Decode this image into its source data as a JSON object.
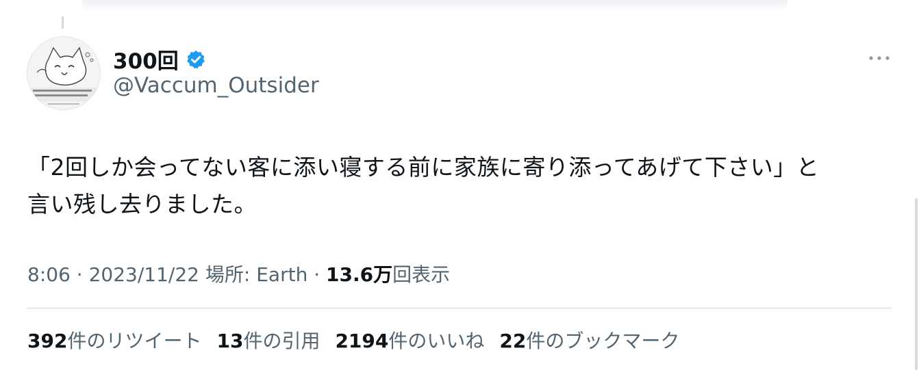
{
  "author": {
    "display_name": "300回",
    "handle": "@Vaccum_Outsider",
    "verified": true,
    "verified_color": "#1d9bf0",
    "avatar_icon": "cat-illustration-avatar-icon"
  },
  "tweet": {
    "text_line1": "「2回しか会ってない客に添い寝する前に家族に寄り添ってあげて下さい」と",
    "text_line2": "言い残し去りました。"
  },
  "meta": {
    "time": "8:06",
    "sep1": " · ",
    "date": "2023/11/22",
    "location_label": "場所: Earth",
    "sep2": " · ",
    "views_count": "13.6万",
    "views_label": "回表示"
  },
  "stats": {
    "retweets_count": "392",
    "retweets_label": "件のリツイート",
    "quotes_count": "13",
    "quotes_label": "件の引用",
    "likes_count": "2194",
    "likes_label": "件のいいね",
    "bookmarks_count": "22",
    "bookmarks_label": "件のブックマーク"
  },
  "colors": {
    "text_primary": "#0f1419",
    "text_secondary": "#536471",
    "divider": "#cfd9de"
  }
}
